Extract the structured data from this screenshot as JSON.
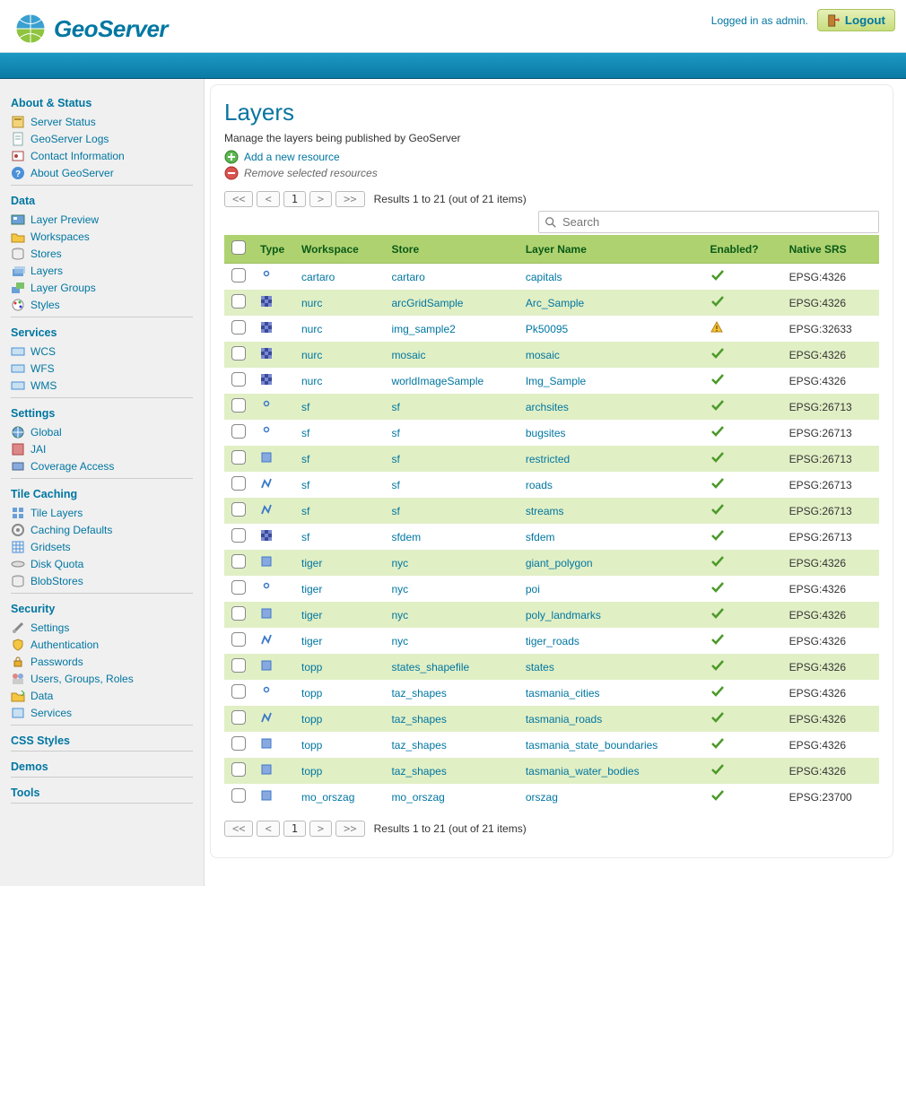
{
  "login": {
    "text": "Logged in as admin.",
    "logout": "Logout"
  },
  "brand": "GeoServer",
  "sidebar": {
    "about_status": {
      "head": "About & Status",
      "items": [
        "Server Status",
        "GeoServer Logs",
        "Contact Information",
        "About GeoServer"
      ]
    },
    "data": {
      "head": "Data",
      "items": [
        "Layer Preview",
        "Workspaces",
        "Stores",
        "Layers",
        "Layer Groups",
        "Styles"
      ]
    },
    "services": {
      "head": "Services",
      "items": [
        "WCS",
        "WFS",
        "WMS"
      ]
    },
    "settings": {
      "head": "Settings",
      "items": [
        "Global",
        "JAI",
        "Coverage Access"
      ]
    },
    "tile": {
      "head": "Tile Caching",
      "items": [
        "Tile Layers",
        "Caching Defaults",
        "Gridsets",
        "Disk Quota",
        "BlobStores"
      ]
    },
    "security": {
      "head": "Security",
      "items": [
        "Settings",
        "Authentication",
        "Passwords",
        "Users, Groups, Roles",
        "Data",
        "Services"
      ]
    },
    "extra": [
      "CSS Styles",
      "Demos",
      "Tools"
    ]
  },
  "page": {
    "title": "Layers",
    "subtitle": "Manage the layers being published by GeoServer",
    "add": "Add a new resource",
    "remove": "Remove selected resources",
    "results": "Results 1 to 21 (out of 21 items)",
    "page_num": "1",
    "search_placeholder": "Search"
  },
  "table": {
    "headers": {
      "type": "Type",
      "workspace": "Workspace",
      "store": "Store",
      "name": "Layer Name",
      "enabled": "Enabled?",
      "srs": "Native SRS"
    },
    "rows": [
      {
        "type": "point",
        "ws": "cartaro",
        "store": "cartaro",
        "name": "capitals",
        "en": "ok",
        "srs": "EPSG:4326"
      },
      {
        "type": "raster",
        "ws": "nurc",
        "store": "arcGridSample",
        "name": "Arc_Sample",
        "en": "ok",
        "srs": "EPSG:4326"
      },
      {
        "type": "raster",
        "ws": "nurc",
        "store": "img_sample2",
        "name": "Pk50095",
        "en": "warn",
        "srs": "EPSG:32633"
      },
      {
        "type": "raster",
        "ws": "nurc",
        "store": "mosaic",
        "name": "mosaic",
        "en": "ok",
        "srs": "EPSG:4326"
      },
      {
        "type": "raster",
        "ws": "nurc",
        "store": "worldImageSample",
        "name": "Img_Sample",
        "en": "ok",
        "srs": "EPSG:4326"
      },
      {
        "type": "point",
        "ws": "sf",
        "store": "sf",
        "name": "archsites",
        "en": "ok",
        "srs": "EPSG:26713"
      },
      {
        "type": "point",
        "ws": "sf",
        "store": "sf",
        "name": "bugsites",
        "en": "ok",
        "srs": "EPSG:26713"
      },
      {
        "type": "poly",
        "ws": "sf",
        "store": "sf",
        "name": "restricted",
        "en": "ok",
        "srs": "EPSG:26713"
      },
      {
        "type": "line",
        "ws": "sf",
        "store": "sf",
        "name": "roads",
        "en": "ok",
        "srs": "EPSG:26713"
      },
      {
        "type": "line",
        "ws": "sf",
        "store": "sf",
        "name": "streams",
        "en": "ok",
        "srs": "EPSG:26713"
      },
      {
        "type": "raster",
        "ws": "sf",
        "store": "sfdem",
        "name": "sfdem",
        "en": "ok",
        "srs": "EPSG:26713"
      },
      {
        "type": "poly",
        "ws": "tiger",
        "store": "nyc",
        "name": "giant_polygon",
        "en": "ok",
        "srs": "EPSG:4326"
      },
      {
        "type": "point",
        "ws": "tiger",
        "store": "nyc",
        "name": "poi",
        "en": "ok",
        "srs": "EPSG:4326"
      },
      {
        "type": "poly",
        "ws": "tiger",
        "store": "nyc",
        "name": "poly_landmarks",
        "en": "ok",
        "srs": "EPSG:4326"
      },
      {
        "type": "line",
        "ws": "tiger",
        "store": "nyc",
        "name": "tiger_roads",
        "en": "ok",
        "srs": "EPSG:4326"
      },
      {
        "type": "poly",
        "ws": "topp",
        "store": "states_shapefile",
        "name": "states",
        "en": "ok",
        "srs": "EPSG:4326"
      },
      {
        "type": "point",
        "ws": "topp",
        "store": "taz_shapes",
        "name": "tasmania_cities",
        "en": "ok",
        "srs": "EPSG:4326"
      },
      {
        "type": "line",
        "ws": "topp",
        "store": "taz_shapes",
        "name": "tasmania_roads",
        "en": "ok",
        "srs": "EPSG:4326"
      },
      {
        "type": "poly",
        "ws": "topp",
        "store": "taz_shapes",
        "name": "tasmania_state_boundaries",
        "en": "ok",
        "srs": "EPSG:4326"
      },
      {
        "type": "poly",
        "ws": "topp",
        "store": "taz_shapes",
        "name": "tasmania_water_bodies",
        "en": "ok",
        "srs": "EPSG:4326"
      },
      {
        "type": "poly",
        "ws": "mo_orszag",
        "store": "mo_orszag",
        "name": "orszag",
        "en": "ok",
        "srs": "EPSG:23700"
      }
    ]
  }
}
